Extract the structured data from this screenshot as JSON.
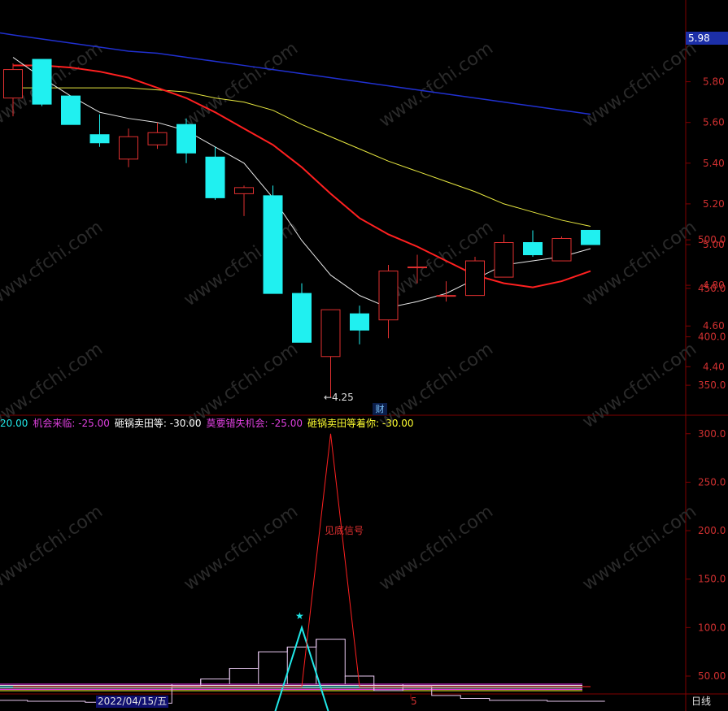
{
  "price_panel": {
    "current_price_tag": "5.98",
    "low_marker": "←4.25",
    "cai_badge": "财",
    "y_ticks": [
      "5.80",
      "5.60",
      "5.40",
      "5.20",
      "5.00",
      "4.80",
      "4.60",
      "4.40"
    ]
  },
  "indicator_panel": {
    "legend": [
      {
        "label": "20.00",
        "color": "#20e8e8"
      },
      {
        "label": "机会来临: -25.00",
        "color": "#e040e0"
      },
      {
        "label": "砸锅卖田等: -30.00",
        "color": "#ffffff"
      },
      {
        "label": "莫要错失机会: -25.00",
        "color": "#e040e0"
      },
      {
        "label": "砸锅卖田等着你: -30.00",
        "color": "#ffff30"
      }
    ],
    "signal_label": "见底信号",
    "star": "★",
    "y_ticks": [
      "500.0",
      "450.0",
      "400.0",
      "350.0",
      "300.0",
      "250.0",
      "200.0",
      "150.0",
      "100.0",
      "50.00"
    ]
  },
  "footer": {
    "date": "2022/04/15/五",
    "x_tick": "5",
    "period_tab": "日线"
  },
  "colors": {
    "up": "#e03030",
    "down": "#20f0f0",
    "ma_white": "#e8e8e8",
    "ma_yellow": "#e8e840",
    "ma_red": "#ff2020",
    "ma_blue": "#2030d0",
    "grid": "#800000"
  },
  "chart_data": [
    {
      "type": "candlestick",
      "ylim": [
        4.2,
        6.2
      ],
      "candles": [
        {
          "open": 5.72,
          "high": 5.89,
          "low": 5.63,
          "close": 5.86
        },
        {
          "open": 5.91,
          "high": 5.91,
          "low": 5.68,
          "close": 5.69
        },
        {
          "open": 5.73,
          "high": 5.73,
          "low": 5.59,
          "close": 5.59
        },
        {
          "open": 5.54,
          "high": 5.64,
          "low": 5.48,
          "close": 5.5
        },
        {
          "open": 5.42,
          "high": 5.57,
          "low": 5.38,
          "close": 5.53
        },
        {
          "open": 5.49,
          "high": 5.6,
          "low": 5.47,
          "close": 5.55
        },
        {
          "open": 5.59,
          "high": 5.62,
          "low": 5.4,
          "close": 5.45
        },
        {
          "open": 5.43,
          "high": 5.48,
          "low": 5.22,
          "close": 5.23
        },
        {
          "open": 5.25,
          "high": 5.29,
          "low": 5.14,
          "close": 5.28
        },
        {
          "open": 5.24,
          "high": 5.29,
          "low": 4.76,
          "close": 4.76
        },
        {
          "open": 4.76,
          "high": 4.81,
          "low": 4.52,
          "close": 4.52
        },
        {
          "open": 4.45,
          "high": 4.68,
          "low": 4.25,
          "close": 4.68
        },
        {
          "open": 4.66,
          "high": 4.7,
          "low": 4.51,
          "close": 4.58
        },
        {
          "open": 4.63,
          "high": 4.9,
          "low": 4.54,
          "close": 4.87
        },
        {
          "open": 4.89,
          "high": 4.95,
          "low": 4.81,
          "close": 4.89
        },
        {
          "open": 4.75,
          "high": 4.82,
          "low": 4.72,
          "close": 4.75
        },
        {
          "open": 4.75,
          "high": 4.94,
          "low": 4.75,
          "close": 4.92
        },
        {
          "open": 4.84,
          "high": 5.05,
          "low": 4.84,
          "close": 5.01
        },
        {
          "open": 5.01,
          "high": 5.07,
          "low": 4.94,
          "close": 4.95
        },
        {
          "open": 4.92,
          "high": 5.04,
          "low": 4.92,
          "close": 5.03
        },
        {
          "open": 5.07,
          "high": 5.07,
          "low": 5.0,
          "close": 5.0
        }
      ],
      "ma_white": [
        5.92,
        5.82,
        5.73,
        5.65,
        5.62,
        5.6,
        5.56,
        5.48,
        5.4,
        5.23,
        5.02,
        4.85,
        4.75,
        4.69,
        4.72,
        4.76,
        4.83,
        4.9,
        4.92,
        4.94,
        4.98
      ],
      "ma_yellow": [
        5.77,
        5.77,
        5.77,
        5.77,
        5.77,
        5.76,
        5.75,
        5.72,
        5.7,
        5.66,
        5.59,
        5.53,
        5.47,
        5.41,
        5.36,
        5.31,
        5.26,
        5.2,
        5.16,
        5.12,
        5.09
      ],
      "ma_red": [
        5.88,
        5.88,
        5.87,
        5.85,
        5.82,
        5.77,
        5.72,
        5.65,
        5.57,
        5.49,
        5.38,
        5.25,
        5.13,
        5.05,
        4.99,
        4.92,
        4.85,
        4.81,
        4.79,
        4.82,
        4.87
      ],
      "ma_blue": [
        6.03,
        6.01,
        5.99,
        5.97,
        5.95,
        5.94,
        5.92,
        5.9,
        5.88,
        5.86,
        5.84,
        5.82,
        5.8,
        5.78,
        5.76,
        5.74,
        5.72,
        5.7,
        5.68,
        5.66,
        5.64
      ]
    },
    {
      "type": "line",
      "ylim": [
        -30,
        525
      ],
      "cyan_line": [
        6,
        6,
        6,
        6,
        6,
        6,
        6,
        6,
        6,
        6,
        100,
        6,
        6,
        6,
        6,
        6,
        6,
        6,
        6,
        6,
        6
      ],
      "red_peak": [
        0,
        0,
        0,
        0,
        0,
        0,
        0,
        0,
        0,
        0,
        0,
        300,
        0,
        0,
        0,
        0,
        0,
        0,
        0,
        0,
        0
      ],
      "steps": [
        25,
        24,
        24,
        23,
        23,
        22,
        40,
        47,
        58,
        75,
        80,
        88,
        50,
        35,
        40,
        30,
        27,
        25,
        25,
        24,
        24
      ]
    }
  ]
}
